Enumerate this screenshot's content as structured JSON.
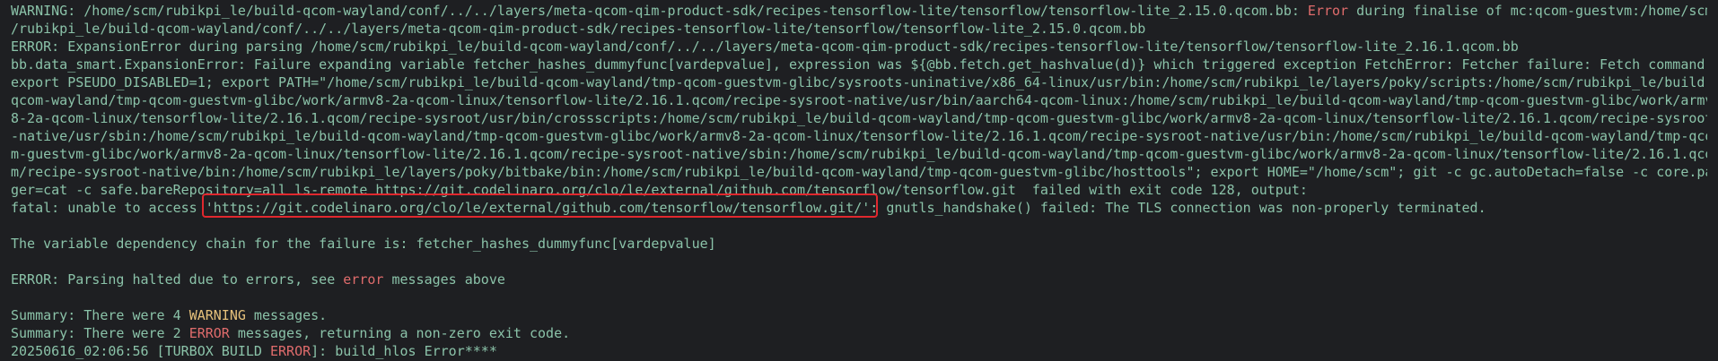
{
  "terminal": {
    "lines": [
      {
        "pre": "WARNING: /home/scm/rubikpi_le/build-qcom-wayland/conf/../../layers/meta-qcom-qim-product-sdk/recipes-tensorflow-lite/tensorflow/tensorflow-lite_2.15.0.qcom.bb: ",
        "red": "Error",
        "post": " during finalise of mc:qcom-guestvm:/home/scm"
      },
      {
        "text": "/rubikpi_le/build-qcom-wayland/conf/../../layers/meta-qcom-qim-product-sdk/recipes-tensorflow-lite/tensorflow/tensorflow-lite_2.15.0.qcom.bb"
      },
      {
        "text": "ERROR: ExpansionError during parsing /home/scm/rubikpi_le/build-qcom-wayland/conf/../../layers/meta-qcom-qim-product-sdk/recipes-tensorflow-lite/tensorflow/tensorflow-lite_2.16.1.qcom.bb"
      },
      {
        "text": "bb.data_smart.ExpansionError: Failure expanding variable fetcher_hashes_dummyfunc[vardepvalue], expression was ${@bb.fetch.get_hashvalue(d)} which triggered exception FetchError: Fetcher failure: Fetch command"
      },
      {
        "text": "export PSEUDO_DISABLED=1; export PATH=\"/home/scm/rubikpi_le/build-qcom-wayland/tmp-qcom-guestvm-glibc/sysroots-uninative/x86_64-linux/usr/bin:/home/scm/rubikpi_le/layers/poky/scripts:/home/scm/rubikpi_le/build-"
      },
      {
        "text": "qcom-wayland/tmp-qcom-guestvm-glibc/work/armv8-2a-qcom-linux/tensorflow-lite/2.16.1.qcom/recipe-sysroot-native/usr/bin/aarch64-qcom-linux:/home/scm/rubikpi_le/build-qcom-wayland/tmp-qcom-guestvm-glibc/work/armv"
      },
      {
        "text": "8-2a-qcom-linux/tensorflow-lite/2.16.1.qcom/recipe-sysroot/usr/bin/crossscripts:/home/scm/rubikpi_le/build-qcom-wayland/tmp-qcom-guestvm-glibc/work/armv8-2a-qcom-linux/tensorflow-lite/2.16.1.qcom/recipe-sysroot"
      },
      {
        "text": "-native/usr/sbin:/home/scm/rubikpi_le/build-qcom-wayland/tmp-qcom-guestvm-glibc/work/armv8-2a-qcom-linux/tensorflow-lite/2.16.1.qcom/recipe-sysroot-native/usr/bin:/home/scm/rubikpi_le/build-qcom-wayland/tmp-qco"
      },
      {
        "text": "m-guestvm-glibc/work/armv8-2a-qcom-linux/tensorflow-lite/2.16.1.qcom/recipe-sysroot-native/sbin:/home/scm/rubikpi_le/build-qcom-wayland/tmp-qcom-guestvm-glibc/work/armv8-2a-qcom-linux/tensorflow-lite/2.16.1.qco"
      },
      {
        "text": "m/recipe-sysroot-native/bin:/home/scm/rubikpi_le/layers/poky/bitbake/bin:/home/scm/rubikpi_le/build-qcom-wayland/tmp-qcom-guestvm-glibc/hosttools\"; export HOME=\"/home/scm\"; git -c gc.autoDetach=false -c core.pa"
      },
      {
        "text": "ger=cat -c safe.bareRepository=all ls-remote https://git.codelinaro.org/clo/le/external/github.com/tensorflow/tensorflow.git  failed with exit code 128, output:"
      },
      {
        "text": "fatal: unable to access 'https://git.codelinaro.org/clo/le/external/github.com/tensorflow/tensorflow.git/': gnutls_handshake() failed: The TLS connection was non-properly terminated."
      },
      {
        "text": ""
      },
      {
        "text": "The variable dependency chain for the failure is: fetcher_hashes_dummyfunc[vardepvalue]"
      },
      {
        "text": ""
      },
      {
        "pre": "ERROR: Parsing halted due to errors, see ",
        "red": "error",
        "post": " messages above"
      },
      {
        "text": ""
      },
      {
        "pre": "Summary: There were 4 ",
        "yellow": "WARNING",
        "post": " messages."
      },
      {
        "pre": "Summary: There were 2 ",
        "red": "ERROR",
        "post": " messages, returning a non-zero exit code."
      },
      {
        "pre": "20250616_02:06:56 [TURBOX BUILD ",
        "red": "ERROR",
        "post": "]: build_hlos Error****"
      }
    ]
  },
  "colors": {
    "text": "#8bc3a9",
    "error": "#e06c6c",
    "warning": "#e5c07b",
    "highlight": "#e0282e",
    "background": "#1e1f22"
  }
}
